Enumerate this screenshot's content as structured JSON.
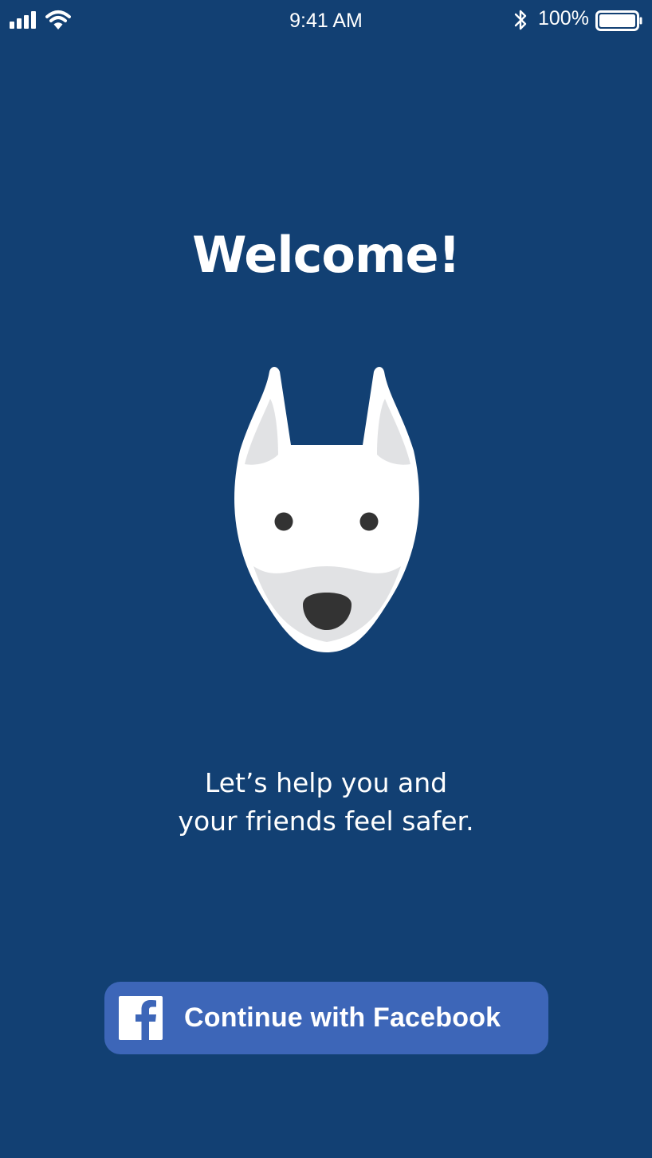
{
  "status_bar": {
    "time": "9:41 AM",
    "battery_percent": "100%",
    "battery_level": 1.0,
    "icons": [
      "cellular-signal-icon",
      "wifi-icon",
      "bluetooth-icon",
      "battery-icon"
    ]
  },
  "welcome": {
    "title": "Welcome!",
    "tagline_line1": "Let’s help you and",
    "tagline_line2": "your friends feel safer."
  },
  "mascot": {
    "icon": "dog-face-icon"
  },
  "facebook_button": {
    "label": "Continue with Facebook",
    "icon": "facebook-logo-icon"
  },
  "colors": {
    "background": "#124073",
    "facebook_button": "#3d66b8",
    "text": "#ffffff",
    "dog_face": "#ffffff",
    "dog_inner": "#e1e2e4",
    "dog_features": "#333333"
  }
}
